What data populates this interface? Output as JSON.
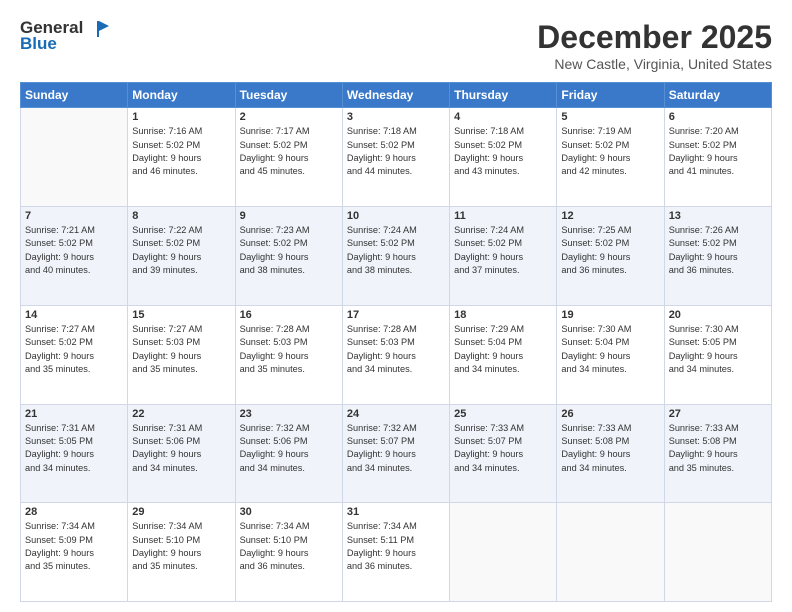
{
  "header": {
    "logo": {
      "line1": "General",
      "line2": "Blue"
    },
    "title": "December 2025",
    "location": "New Castle, Virginia, United States"
  },
  "weekdays": [
    "Sunday",
    "Monday",
    "Tuesday",
    "Wednesday",
    "Thursday",
    "Friday",
    "Saturday"
  ],
  "weeks": [
    [
      {
        "day": "",
        "content": ""
      },
      {
        "day": "1",
        "content": "Sunrise: 7:16 AM\nSunset: 5:02 PM\nDaylight: 9 hours\nand 46 minutes."
      },
      {
        "day": "2",
        "content": "Sunrise: 7:17 AM\nSunset: 5:02 PM\nDaylight: 9 hours\nand 45 minutes."
      },
      {
        "day": "3",
        "content": "Sunrise: 7:18 AM\nSunset: 5:02 PM\nDaylight: 9 hours\nand 44 minutes."
      },
      {
        "day": "4",
        "content": "Sunrise: 7:18 AM\nSunset: 5:02 PM\nDaylight: 9 hours\nand 43 minutes."
      },
      {
        "day": "5",
        "content": "Sunrise: 7:19 AM\nSunset: 5:02 PM\nDaylight: 9 hours\nand 42 minutes."
      },
      {
        "day": "6",
        "content": "Sunrise: 7:20 AM\nSunset: 5:02 PM\nDaylight: 9 hours\nand 41 minutes."
      }
    ],
    [
      {
        "day": "7",
        "content": "Sunrise: 7:21 AM\nSunset: 5:02 PM\nDaylight: 9 hours\nand 40 minutes."
      },
      {
        "day": "8",
        "content": "Sunrise: 7:22 AM\nSunset: 5:02 PM\nDaylight: 9 hours\nand 39 minutes."
      },
      {
        "day": "9",
        "content": "Sunrise: 7:23 AM\nSunset: 5:02 PM\nDaylight: 9 hours\nand 38 minutes."
      },
      {
        "day": "10",
        "content": "Sunrise: 7:24 AM\nSunset: 5:02 PM\nDaylight: 9 hours\nand 38 minutes."
      },
      {
        "day": "11",
        "content": "Sunrise: 7:24 AM\nSunset: 5:02 PM\nDaylight: 9 hours\nand 37 minutes."
      },
      {
        "day": "12",
        "content": "Sunrise: 7:25 AM\nSunset: 5:02 PM\nDaylight: 9 hours\nand 36 minutes."
      },
      {
        "day": "13",
        "content": "Sunrise: 7:26 AM\nSunset: 5:02 PM\nDaylight: 9 hours\nand 36 minutes."
      }
    ],
    [
      {
        "day": "14",
        "content": "Sunrise: 7:27 AM\nSunset: 5:02 PM\nDaylight: 9 hours\nand 35 minutes."
      },
      {
        "day": "15",
        "content": "Sunrise: 7:27 AM\nSunset: 5:03 PM\nDaylight: 9 hours\nand 35 minutes."
      },
      {
        "day": "16",
        "content": "Sunrise: 7:28 AM\nSunset: 5:03 PM\nDaylight: 9 hours\nand 35 minutes."
      },
      {
        "day": "17",
        "content": "Sunrise: 7:28 AM\nSunset: 5:03 PM\nDaylight: 9 hours\nand 34 minutes."
      },
      {
        "day": "18",
        "content": "Sunrise: 7:29 AM\nSunset: 5:04 PM\nDaylight: 9 hours\nand 34 minutes."
      },
      {
        "day": "19",
        "content": "Sunrise: 7:30 AM\nSunset: 5:04 PM\nDaylight: 9 hours\nand 34 minutes."
      },
      {
        "day": "20",
        "content": "Sunrise: 7:30 AM\nSunset: 5:05 PM\nDaylight: 9 hours\nand 34 minutes."
      }
    ],
    [
      {
        "day": "21",
        "content": "Sunrise: 7:31 AM\nSunset: 5:05 PM\nDaylight: 9 hours\nand 34 minutes."
      },
      {
        "day": "22",
        "content": "Sunrise: 7:31 AM\nSunset: 5:06 PM\nDaylight: 9 hours\nand 34 minutes."
      },
      {
        "day": "23",
        "content": "Sunrise: 7:32 AM\nSunset: 5:06 PM\nDaylight: 9 hours\nand 34 minutes."
      },
      {
        "day": "24",
        "content": "Sunrise: 7:32 AM\nSunset: 5:07 PM\nDaylight: 9 hours\nand 34 minutes."
      },
      {
        "day": "25",
        "content": "Sunrise: 7:33 AM\nSunset: 5:07 PM\nDaylight: 9 hours\nand 34 minutes."
      },
      {
        "day": "26",
        "content": "Sunrise: 7:33 AM\nSunset: 5:08 PM\nDaylight: 9 hours\nand 34 minutes."
      },
      {
        "day": "27",
        "content": "Sunrise: 7:33 AM\nSunset: 5:08 PM\nDaylight: 9 hours\nand 35 minutes."
      }
    ],
    [
      {
        "day": "28",
        "content": "Sunrise: 7:34 AM\nSunset: 5:09 PM\nDaylight: 9 hours\nand 35 minutes."
      },
      {
        "day": "29",
        "content": "Sunrise: 7:34 AM\nSunset: 5:10 PM\nDaylight: 9 hours\nand 35 minutes."
      },
      {
        "day": "30",
        "content": "Sunrise: 7:34 AM\nSunset: 5:10 PM\nDaylight: 9 hours\nand 36 minutes."
      },
      {
        "day": "31",
        "content": "Sunrise: 7:34 AM\nSunset: 5:11 PM\nDaylight: 9 hours\nand 36 minutes."
      },
      {
        "day": "",
        "content": ""
      },
      {
        "day": "",
        "content": ""
      },
      {
        "day": "",
        "content": ""
      }
    ]
  ]
}
